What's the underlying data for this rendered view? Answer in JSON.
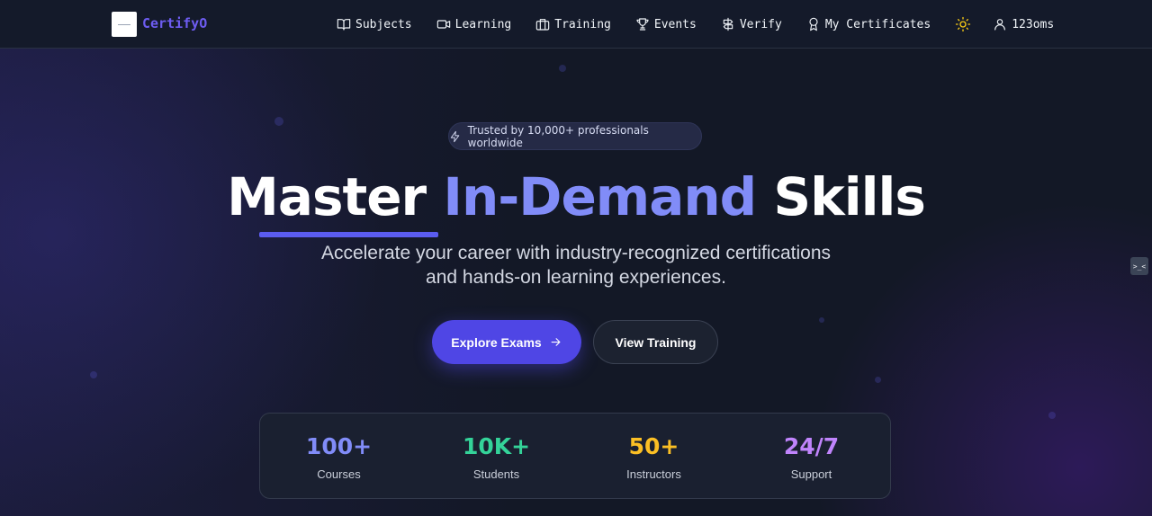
{
  "brand": {
    "name": "CertifyO"
  },
  "nav": {
    "items": [
      {
        "label": "Subjects",
        "icon": "book-open-icon"
      },
      {
        "label": "Learning",
        "icon": "video-camera-icon"
      },
      {
        "label": "Training",
        "icon": "briefcase-icon"
      },
      {
        "label": "Events",
        "icon": "trophy-icon"
      },
      {
        "label": "Verify",
        "icon": "signpost-icon"
      },
      {
        "label": "My Certificates",
        "icon": "award-icon"
      }
    ],
    "theme_toggle_icon": "sun-icon",
    "user": {
      "label": "123oms",
      "icon": "user-icon"
    }
  },
  "hero": {
    "badge": "Trusted by 10,000+ professionals worldwide",
    "headline": {
      "part1": "Master",
      "accent": "In-Demand",
      "part2": "Skills"
    },
    "subtitle_line1": "Accelerate your career with industry-recognized certifications",
    "subtitle_line2": "and hands-on learning experiences.",
    "primary_button": "Explore Exams",
    "secondary_button": "View Training"
  },
  "stats": [
    {
      "value": "100+",
      "label": "Courses",
      "color": "#818cf8"
    },
    {
      "value": "10K+",
      "label": "Students",
      "color": "#34d399"
    },
    {
      "value": "50+",
      "label": "Instructors",
      "color": "#fbbf24"
    },
    {
      "value": "24/7",
      "label": "Support",
      "color": "#c084fc"
    }
  ],
  "colors": {
    "accent": "#818cf8",
    "primary_button": "#4f46e5",
    "brand": "#6d5cf0",
    "background": "#131826"
  },
  "side_widget": {
    "label": ">_<"
  }
}
